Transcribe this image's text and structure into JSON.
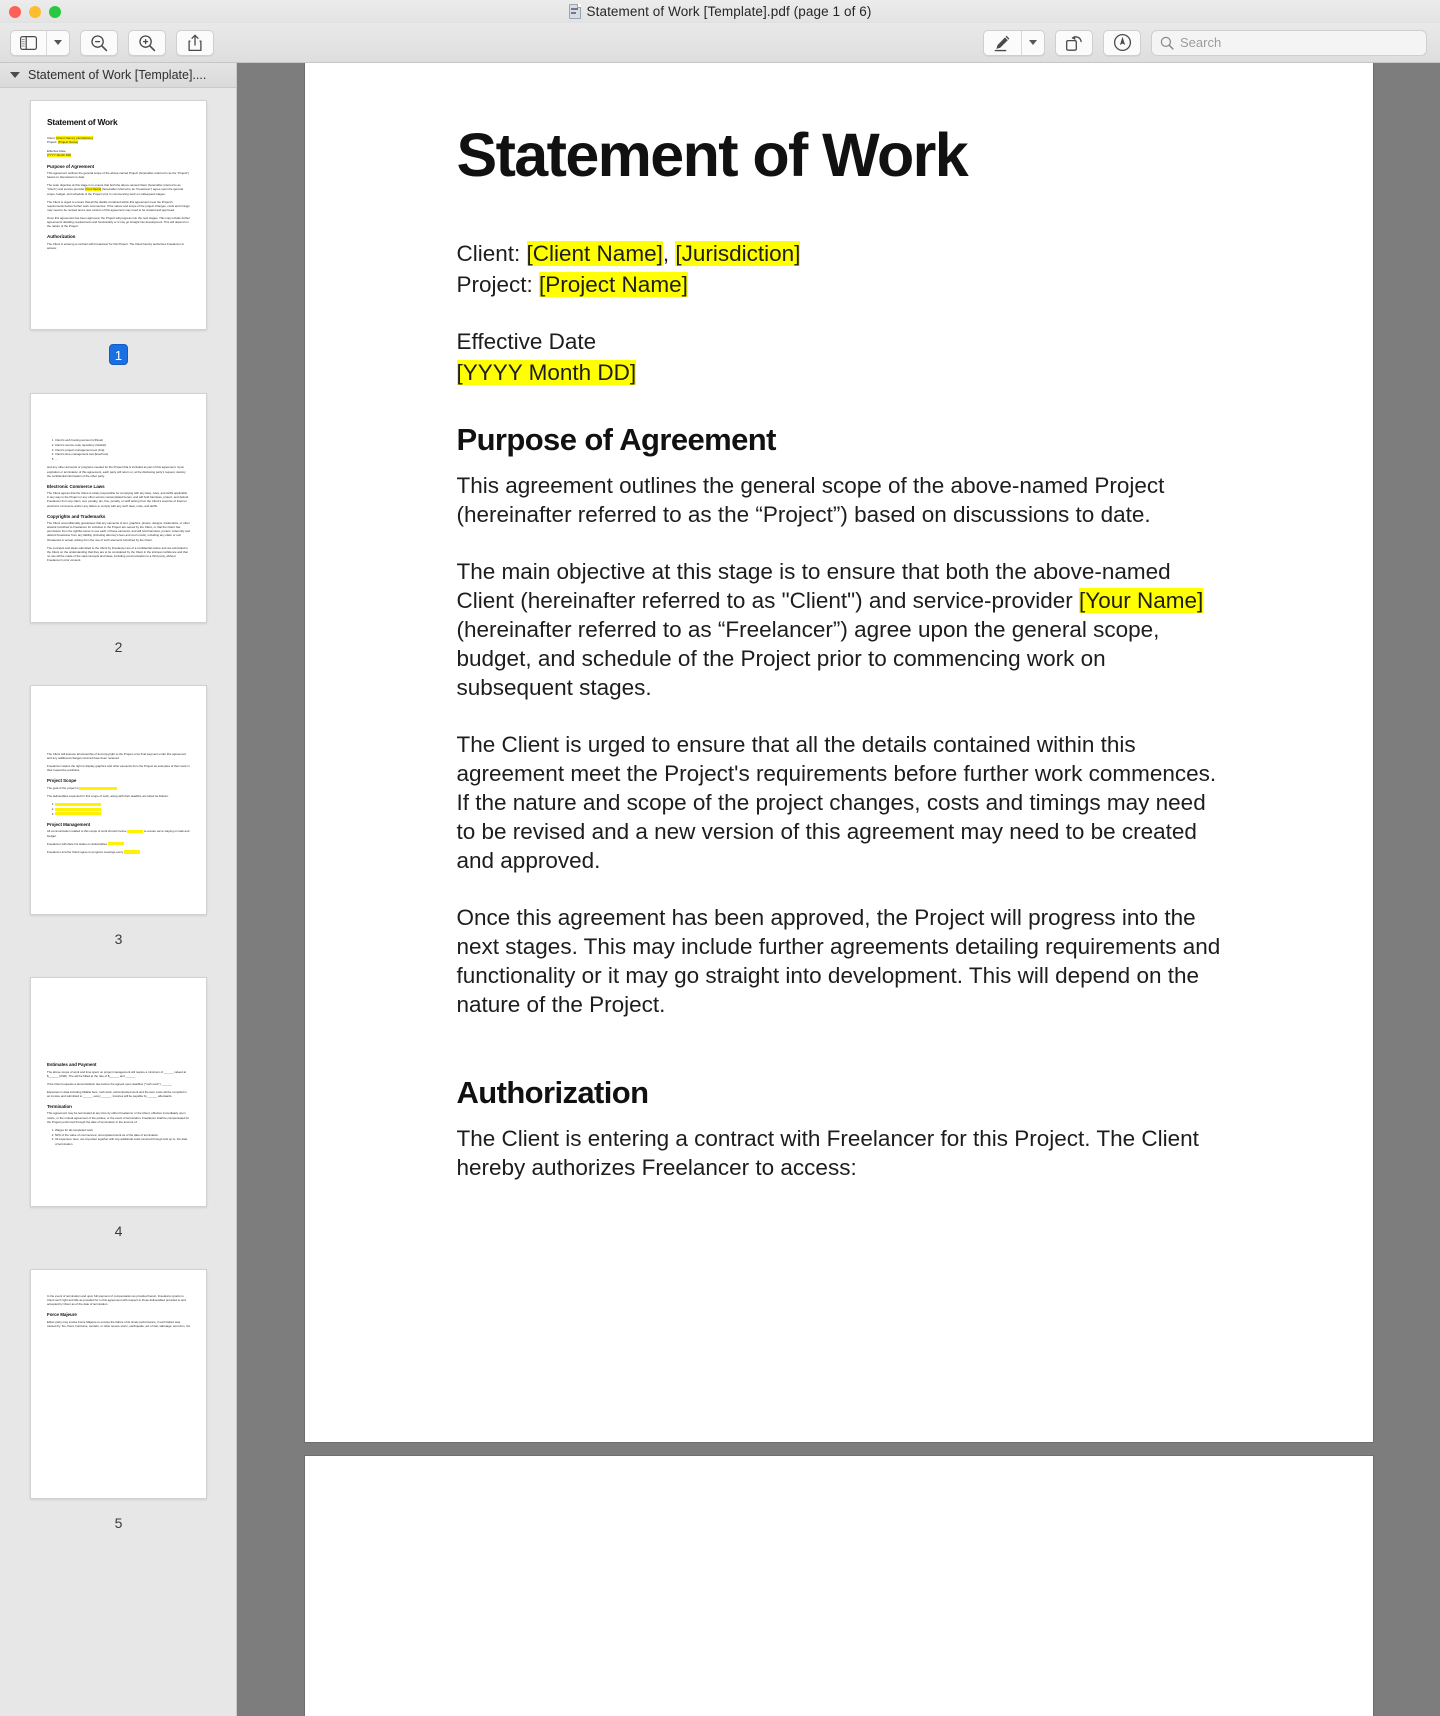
{
  "window": {
    "title": "Statement of Work [Template].pdf (page 1 of 6)",
    "traffic_lights": {
      "close": "close",
      "minimize": "minimize",
      "maximize": "maximize"
    }
  },
  "toolbar": {
    "sidebar_button": "Sidebar",
    "sidebar_dropdown": "View options",
    "zoom_out_button": "Zoom Out",
    "zoom_in_button": "Zoom In",
    "share_button": "Share",
    "markup_button": "Markup",
    "markup_dropdown": "Markup options",
    "rotate_button": "Rotate",
    "annotate_button": "Annotate",
    "search": {
      "placeholder": "Search",
      "value": ""
    }
  },
  "sidebar": {
    "header_title": "Statement of Work [Template]....",
    "thumbnails": [
      {
        "label": "1",
        "selected": true
      },
      {
        "label": "2",
        "selected": false
      },
      {
        "label": "3",
        "selected": false
      },
      {
        "label": "4",
        "selected": false
      },
      {
        "label": "5",
        "selected": false
      }
    ]
  },
  "document": {
    "title": "Statement of Work",
    "client_label": "Client: ",
    "client_name": "[Client Name]",
    "client_sep": ", ",
    "client_jurisdiction": "[Jurisdiction]",
    "project_label": "Project: ",
    "project_name": "[Project Name]",
    "effective_date_label": "Effective Date",
    "effective_date_value": "[YYYY Month DD]",
    "heading_purpose": "Purpose of Agreement",
    "p1": "This agreement outlines the general scope of the above-named Project (hereinafter referred to as the “Project”) based on discussions to date.",
    "p2_a": "The main objective at this stage is to ensure that both the above-named Client (hereinafter referred to as \"Client\") and service-provider ",
    "p2_hl": "[Your Name]",
    "p2_b": " (hereinafter referred to as “Freelancer”) agree upon the general scope, budget, and schedule of the Project prior to commencing work on subsequent stages.",
    "p3": "The Client is urged to ensure that all the details contained within this agreement meet the Project's requirements before further work commences. If the nature and scope of the project changes, costs and timings may need to be revised and a new version of this agreement may need to be created and approved.",
    "p4": "Once this agreement has been approved, the Project will progress into the next stages. This may include further agreements detailing requirements and functionality or it may go straight into development. This will depend on the nature of the Project.",
    "heading_authorization": "Authorization",
    "p5": "The Client is entering a contract with Freelancer for this Project. The Client hereby authorizes Freelancer to access:"
  },
  "thumb_pages": {
    "p1": {
      "title": "Statement of Work",
      "client_label": "Client: ",
      "client_hl": "[Client Name], [Jurisdiction]",
      "project_label": "Project: ",
      "project_hl": "[Project Name]",
      "effective_label": "Effective Date",
      "effective_hl": "[YYYY Month DD]",
      "h_purpose": "Purpose of Agreement",
      "p1": "This agreement outlines the general scope of the above-named Project (hereinafter referred to as the “Project”) based on discussions to date.",
      "p2a": "The main objective at this stage is to ensure that both the above-named Client (hereinafter referred to as \"Client\") and service-provider ",
      "p2hl": "[Your Name]",
      "p2b": " (hereinafter referred to as “Freelancer”) agree upon the general scope, budget, and schedule of the Project prior to commencing work on subsequent stages.",
      "p3": "The Client is urged to ensure that all the details contained within this agreement meet the Project's requirements before further work commences. If the nature and scope of the project changes, costs and timings may need to be revised and a new version of this agreement may need to be created and approved.",
      "p4": "Once this agreement has been approved, the Project will progress into the next stages. This may include further agreements detailing requirements and functionality or it may go straight into development. This will depend on the nature of the Project.",
      "h_auth": "Authorization",
      "p5": "The Client is entering a contract with Freelancer for this Project. The Client hereby authorizes Freelancer to access:"
    },
    "p2": {
      "list": [
        "Client's web hosting account (cPanel)",
        "Client's source code repository (GitHub)",
        "Client's project management tool (Jira)",
        "Client's time management tool (Everhour)",
        "..."
      ],
      "p1": "and any other accounts or programs needed for the Project that is included as part of this agreement. Upon expiration or termination of this agreement, each party will return or, at the disclosing party's request, destroy the confidential information of the other party.",
      "h1": "Electronic Commerce Laws",
      "p2": "The Client agrees that the Client is solely responsible for complying with any laws, rules, and tariffs applicable in any way to the Project or any other service contemplated herein, and will hold harmless, protect, and defend Freelancer from any claim, suit, penalty, tax, fine, penalty, or tariff arising from the Client's exercise of Internet electronic commerce and/or any failure to comply with any such laws, rules, and tariffs.",
      "h2": "Copyrights and Trademarks",
      "p3": "The Client unconditionally guarantees that any elements of text, graphics, photos, designs, trademarks, or other artwork furnished to Freelancer for inclusion in the Project are owned by the Client, or that the Client has permission from the rightful owner to use each of these elements, and will hold harmless, protect, indemnify and defend Freelancer from any liability (including attorney's fees and court costs), including any claim or suit threatened or actual, arising from the use of such elements furnished by the Client.",
      "p4": "The concepts and ideas submitted to the Client by Freelancer are of a confidential nature and are submitted to the Client on the understanding that they are to be considered by the Client in the strictest confidence and that no use will be made of the said concepts and ideas, including communication to a third party, without Freelancer's prior consent."
    },
    "p3": {
      "p1": "The Client will assume all ownership of and copyright to the Project once final payment under this agreement and any additional charges incurred have been received.",
      "p2": "Freelancer retains the right to display graphics and other elements from the Project as examples of their work in their respective portfolios.",
      "h1": "Project Scope",
      "p3_label": "The goal of the project is ",
      "p4": "The deliverables expected for this scope of work, along with their deadline are listed as follows:",
      "h2": "Project Management",
      "p5a": "All communication related to this scope of work should involve ",
      "p5b": " to ensure we're staying on task and budget.",
      "p6a": "Freelancer will share his status on deliverables ",
      "p7a": "Freelancer and the Client agree to progress meetings every "
    },
    "p4": {
      "h1": "Estimates and Payment",
      "p1": "The above scope of work and time spent on project management will require a minimum of ______ valued at $______ (USD). The will be billed at the rate of $______ and ______.",
      "p2": "If the Client requests a demonstration due before the agreed upon deadline (\"rush work\"), ______",
      "p3": "Expenses in data including billable fees, rush work, subcontracted work and the item costs will be compiled in an invoice and submitted to ______ every ______. Invoices will be payable by ______ afterwards.",
      "h2": "Termination",
      "p4": "This agreement may be terminated at any time by either Freelancer or the Client, effective immediately upon notice, or the mutual agreement of the parties, or the event of termination, Freelancer shall be compensated for the Project performed through the date of termination in the amount of:",
      "bullets": [
        "Wages for all completed work",
        "50% of the value of commenced, uncompleted work as of the date of termination",
        "All expenses, fees, out-of-pocket together with any additional costs incurred through and up to, the date of termination"
      ]
    },
    "p5": {
      "p1": "In the event of termination and upon full payment of compensation as provided herein, Freelancer grants to Client such right and title as provided for in this agreement with respect to those deliverables provided to and accepted by Client as of the date of termination.",
      "h1": "Force Majeure",
      "p2": "Either party may invoke Force Majeure to excuse the failure of its timely performance, if such failure was caused by: fire, flood, hurricane, tornado, or other severe storm, earthquake, act of war, sabotage, terrorism, riot"
    }
  }
}
